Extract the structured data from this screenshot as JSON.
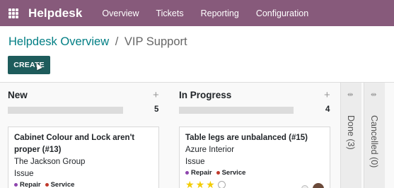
{
  "app": {
    "brand": "Helpdesk",
    "menu": [
      "Overview",
      "Tickets",
      "Reporting",
      "Configuration"
    ]
  },
  "breadcrumb": {
    "parent": "Helpdesk Overview",
    "separator": "/",
    "current": "VIP Support"
  },
  "toolbar": {
    "create_label": "CREATE"
  },
  "columns": [
    {
      "title": "New",
      "count": "5",
      "card": {
        "title": "Cabinet Colour and Lock aren't proper (#13)",
        "customer": "The Jackson Group",
        "type": "Issue",
        "tags": [
          {
            "label": "Repair",
            "color": "#8e44ad"
          },
          {
            "label": "Service",
            "color": "#c0392b"
          }
        ]
      }
    },
    {
      "title": "In Progress",
      "count": "4",
      "card": {
        "title": "Table legs are unbalanced (#15)",
        "customer": "Azure Interior",
        "type": "Issue",
        "tags": [
          {
            "label": "Repair",
            "color": "#8e44ad"
          },
          {
            "label": "Service",
            "color": "#c0392b"
          }
        ],
        "priority_stars": 3
      }
    }
  ],
  "folded_columns": [
    {
      "label": "Done (3)"
    },
    {
      "label": "Cancelled (0)"
    }
  ],
  "colors": {
    "navbar": "#875a7b",
    "link": "#017e84",
    "create_button": "#1e5c5c"
  }
}
